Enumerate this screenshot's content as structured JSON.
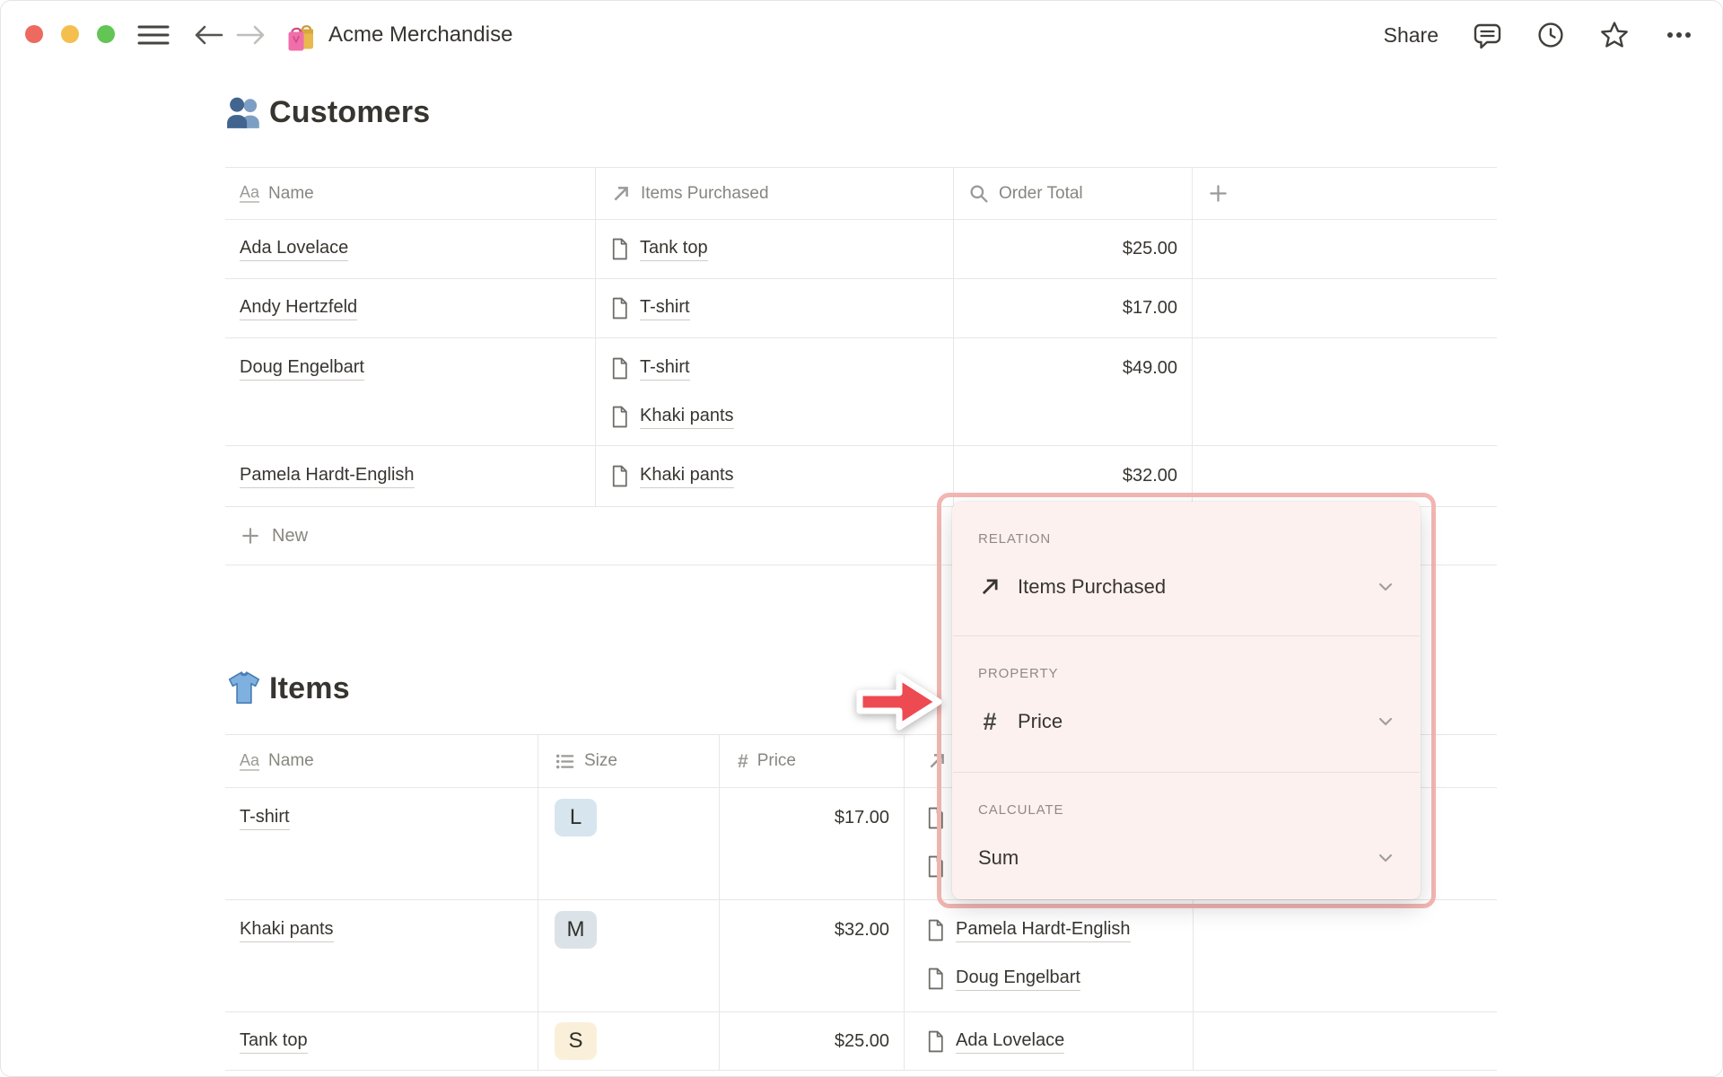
{
  "window": {
    "title": "Acme Merchandise",
    "title_icon": "shopping-bags-emoji"
  },
  "titlebar": {
    "share_label": "Share"
  },
  "icons": {
    "text_type_glyph": "Aa",
    "hash_glyph": "#"
  },
  "customers_section": {
    "heading": "Customers",
    "heading_icon": "busts-in-silhouette-emoji",
    "table": {
      "columns": [
        {
          "icon": "text-type-icon",
          "label": "Name"
        },
        {
          "icon": "relation-arrow-icon",
          "label": "Items Purchased"
        },
        {
          "icon": "rollup-magnifier-icon",
          "label": "Order Total"
        },
        {
          "icon": "plus-icon",
          "label": ""
        }
      ],
      "rows": [
        {
          "name": "Ada Lovelace",
          "items": [
            "Tank top"
          ],
          "order_total": "$25.00"
        },
        {
          "name": "Andy Hertzfeld",
          "items": [
            "T-shirt"
          ],
          "order_total": "$17.00"
        },
        {
          "name": "Doug Engelbart",
          "items": [
            "T-shirt",
            "Khaki pants"
          ],
          "order_total": "$49.00"
        },
        {
          "name": "Pamela Hardt-English",
          "items": [
            "Khaki pants"
          ],
          "order_total": "$32.00"
        }
      ],
      "new_row_label": "New"
    }
  },
  "items_section": {
    "heading": "Items",
    "heading_icon": "tshirt-emoji",
    "table": {
      "columns": [
        {
          "icon": "text-type-icon",
          "label": "Name"
        },
        {
          "icon": "list-icon",
          "label": "Size"
        },
        {
          "icon": "hash-icon",
          "label": "Price"
        },
        {
          "icon": "relation-arrow-icon",
          "label": ""
        }
      ],
      "rows": [
        {
          "name": "T-shirt",
          "size": "L",
          "size_color": "#d7e5ee",
          "price": "$17.00",
          "customers": [],
          "covered_customer_link_icons": 2
        },
        {
          "name": "Khaki pants",
          "size": "M",
          "size_color": "#dbe3e8",
          "price": "$32.00",
          "customers": [
            "Pamela Hardt-English",
            "Doug Engelbart"
          ]
        },
        {
          "name": "Tank top",
          "size": "S",
          "size_color": "#faf0da",
          "price": "$25.00",
          "customers": [
            "Ada Lovelace"
          ]
        }
      ]
    }
  },
  "popup": {
    "relation": {
      "label": "RELATION",
      "value": "Items Purchased",
      "icon": "relation-arrow-icon"
    },
    "property": {
      "label": "PROPERTY",
      "value": "Price",
      "icon": "hash-icon"
    },
    "calculate": {
      "label": "CALCULATE",
      "value": "Sum"
    }
  },
  "colors": {
    "accent_red": "#ee4a52",
    "popup_bg": "#fdf1ef",
    "popup_outline": "#f3b6b2",
    "badge_blue": "#d7e5ee",
    "badge_gray_blue": "#dbe3e8",
    "badge_yellow": "#faf0da",
    "text": "#37352f",
    "muted_text": "#87867f",
    "table_border": "#e8e7e5",
    "traffic_red": "#ec6a5e",
    "traffic_yellow": "#f5bf4f",
    "traffic_green": "#62c554"
  }
}
